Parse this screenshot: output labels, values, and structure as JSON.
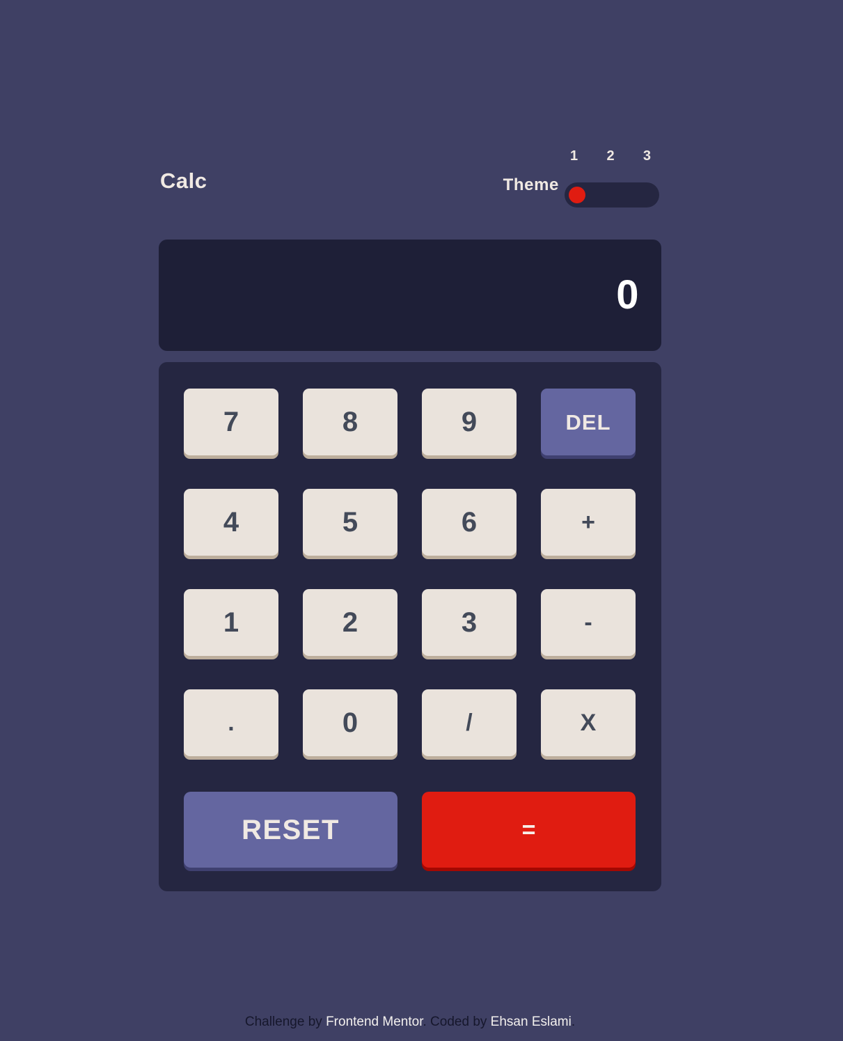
{
  "header": {
    "app_title": "Calc",
    "theme_label": "Theme",
    "theme_options": [
      "1",
      "2",
      "3"
    ],
    "active_theme": "1"
  },
  "display": {
    "value": "0"
  },
  "keypad": {
    "keys": [
      {
        "label": "7",
        "kind": "number",
        "name": "key-7"
      },
      {
        "label": "8",
        "kind": "number",
        "name": "key-8"
      },
      {
        "label": "9",
        "kind": "number",
        "name": "key-9"
      },
      {
        "label": "DEL",
        "kind": "accent",
        "name": "key-delete"
      },
      {
        "label": "4",
        "kind": "number",
        "name": "key-4"
      },
      {
        "label": "5",
        "kind": "number",
        "name": "key-5"
      },
      {
        "label": "6",
        "kind": "number",
        "name": "key-6"
      },
      {
        "label": "+",
        "kind": "operator",
        "name": "key-plus"
      },
      {
        "label": "1",
        "kind": "number",
        "name": "key-1"
      },
      {
        "label": "2",
        "kind": "number",
        "name": "key-2"
      },
      {
        "label": "3",
        "kind": "number",
        "name": "key-3"
      },
      {
        "label": "-",
        "kind": "operator",
        "name": "key-minus"
      },
      {
        "label": ".",
        "kind": "operator",
        "name": "key-decimal"
      },
      {
        "label": "0",
        "kind": "number",
        "name": "key-0"
      },
      {
        "label": "/",
        "kind": "operator",
        "name": "key-divide"
      },
      {
        "label": "X",
        "kind": "operator",
        "name": "key-multiply"
      }
    ],
    "reset_label": "RESET",
    "equals_label": "="
  },
  "footer": {
    "part1": "Challenge by ",
    "link1": "Frontend Mentor",
    "part2": ". Coded by ",
    "link2": "Ehsan Eslami",
    "part3": "."
  },
  "colors": {
    "page_background": "#3f4064",
    "keypad_background": "#252641",
    "display_background": "#1e1f37",
    "key_face": "#eae3dc",
    "key_shadow": "#bdae9c",
    "key_text": "#434a59",
    "accent": "#6466a0",
    "accent_shadow": "#3f4070",
    "equals": "#e01c11",
    "equals_shadow": "#a40802",
    "light_text": "#f0e9e3",
    "footer_text": "#16172c"
  }
}
